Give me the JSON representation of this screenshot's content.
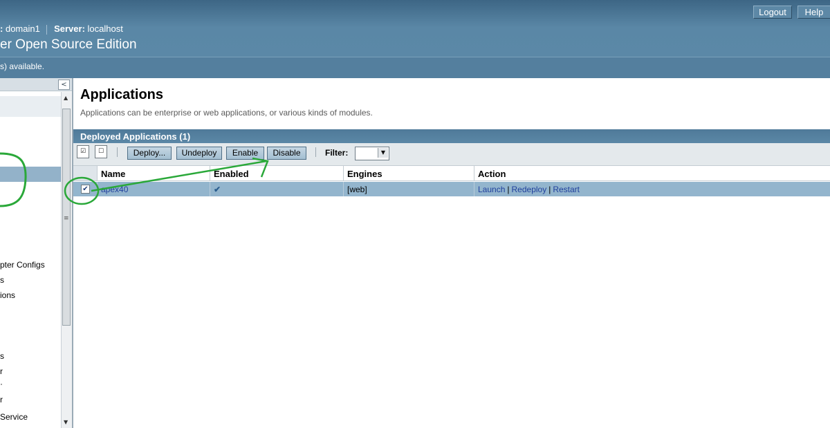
{
  "masthead": {
    "logout_label": "Logout",
    "help_label": "Help",
    "domain_label": ":",
    "domain_value": "domain1",
    "server_label": "Server:",
    "server_value": "localhost",
    "product_title": "er Open Source Edition",
    "availability_text": "s) available."
  },
  "nav": {
    "collapse_symbol": "<",
    "items": [
      {
        "label": "pter Configs"
      },
      {
        "label": "s"
      },
      {
        "label": "ions"
      },
      {
        "label": "s"
      },
      {
        "label": "r"
      },
      {
        "label": "·"
      },
      {
        "label": "r"
      },
      {
        "label": "Service"
      }
    ]
  },
  "page": {
    "title": "Applications",
    "help_text": "Applications can be enterprise or web applications, or various kinds of modules."
  },
  "table": {
    "title": "Deployed Applications (1)",
    "buttons": {
      "deploy": "Deploy...",
      "undeploy": "Undeploy",
      "enable": "Enable",
      "disable": "Disable"
    },
    "filter_label": "Filter:",
    "filter_value": "",
    "columns": [
      "Name",
      "Enabled",
      "Engines",
      "Action"
    ],
    "rows": [
      {
        "selected": true,
        "name": "apex40",
        "enabled_mark": "✔",
        "engines": "[web]",
        "actions": [
          "Launch",
          "Redeploy",
          "Restart"
        ]
      }
    ]
  },
  "colors": {
    "masthead": "#5a87a6",
    "selected_row": "#93b5cd",
    "link": "#1f3f9c",
    "annotation": "#2aa839"
  }
}
